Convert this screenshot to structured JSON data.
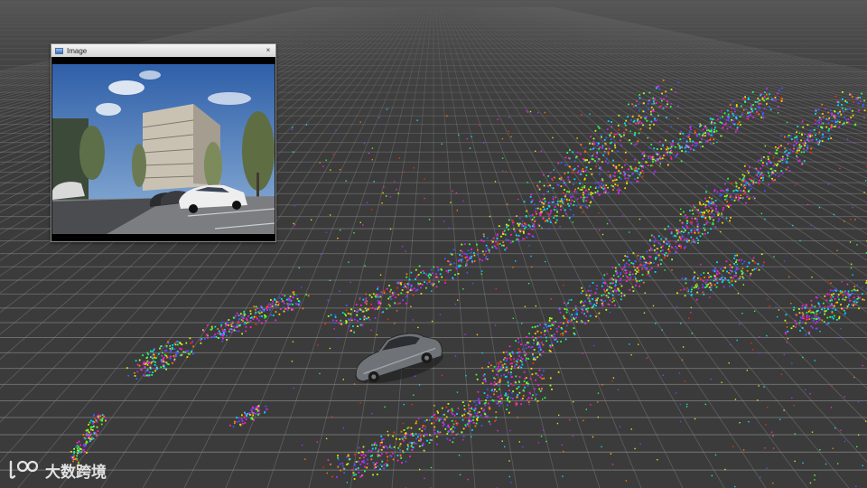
{
  "image_window": {
    "title": "Image",
    "close_glyph": "×",
    "icon": "image-window-icon"
  },
  "watermark": {
    "text": "大数跨境",
    "logo_icon": "kuajing-logo-icon"
  },
  "scene": {
    "background_color": "#3b3b3b",
    "grid_color": "#8c8c8c",
    "vehicle_color": "#7b7f84",
    "pointcloud_palette": [
      "#ff2a00",
      "#ff7a00",
      "#ffd400",
      "#b4ff1a",
      "#2aff4a",
      "#00e0ff",
      "#3a5cff",
      "#b02cff",
      "#ff1fd6"
    ]
  }
}
